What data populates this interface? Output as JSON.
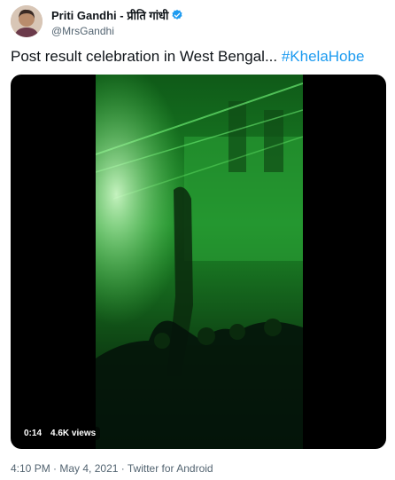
{
  "author": {
    "display_name": "Priti Gandhi - प्रीति गांधी",
    "handle": "@MrsGandhi",
    "verified_icon": "verified-badge-icon",
    "avatar": "avatar-photo"
  },
  "tweet": {
    "text": "Post result celebration in West Bengal... ",
    "hashtag": "#KhelaHobe"
  },
  "video": {
    "timestamp": "0:14",
    "views": "4.6K views"
  },
  "footer": {
    "time": "4:10 PM",
    "separator": " · ",
    "date": "May 4, 2021",
    "source": "Twitter for Android"
  },
  "colors": {
    "link": "#1d9bf0",
    "secondary_text": "#536471",
    "verified": "#1d9bf0",
    "video_green": "#1f8a2a"
  }
}
